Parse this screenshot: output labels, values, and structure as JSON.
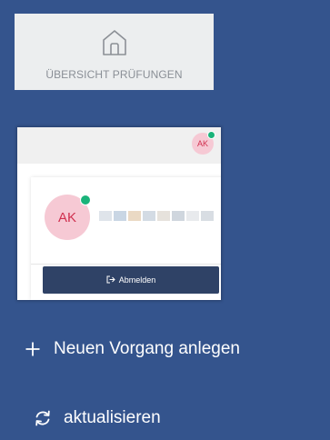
{
  "home_tile": {
    "icon": "home-icon",
    "label": "ÜBERSICHT PRÜFUNGEN"
  },
  "profile_preview": {
    "topbar_avatar_initials": "AK",
    "avatar_initials": "AK",
    "online_status_color": "#1ab37a",
    "logout_icon": "logout-icon",
    "logout_label": "Abmelden"
  },
  "sidebar": {
    "new_case": {
      "icon": "plus-icon",
      "label": "Neuen Vorgang anlegen"
    },
    "refresh": {
      "icon": "refresh-icon",
      "label": "aktualisieren"
    }
  },
  "colors": {
    "sidebar_background": "#34548d",
    "avatar_background": "#f6c9d4",
    "avatar_text": "#d0304f",
    "logout_button": "#2f4266"
  }
}
